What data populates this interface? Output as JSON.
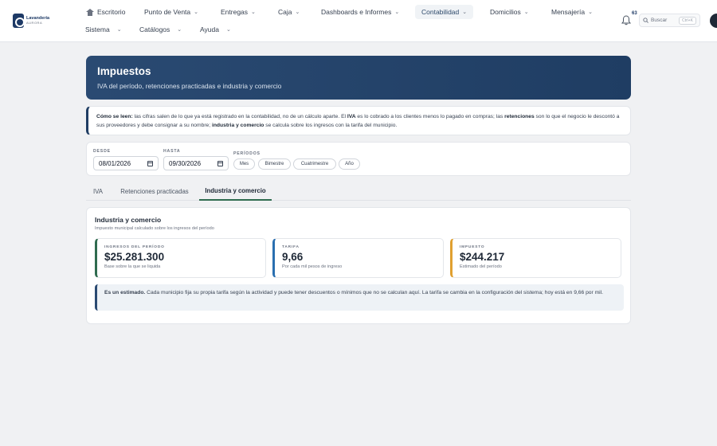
{
  "brand": {
    "line1": "Lavandería",
    "line2": "AURORA"
  },
  "nav": {
    "row1": [
      {
        "label": "Escritorio"
      },
      {
        "label": "Punto de Venta"
      },
      {
        "label": "Entregas"
      },
      {
        "label": "Caja"
      },
      {
        "label": "Dashboards e Informes"
      },
      {
        "label": "Contabilidad"
      },
      {
        "label": "Domicilios"
      },
      {
        "label": "Mensajería"
      }
    ],
    "row2": [
      {
        "label": "Sistema"
      },
      {
        "label": "Catálogos"
      },
      {
        "label": "Ayuda"
      }
    ],
    "active": "Contabilidad",
    "notifications": "63",
    "search_label": "Buscar",
    "search_shortcut": "Ctrl+K"
  },
  "hero": {
    "title": "Impuestos",
    "subtitle": "IVA del período, retenciones practicadas e industria y comercio"
  },
  "info": {
    "lead": "Cómo se leen:",
    "t1": " las cifras salen de lo que ya está registrado en la contabilidad, no de un cálculo aparte. El ",
    "b1": "IVA",
    "t2": " es lo cobrado a los clientes menos lo pagado en compras; las ",
    "b2": "retenciones",
    "t3": " son lo que el negocio le descontó a sus proveedores y debe consignar a su nombre; ",
    "b3": "industria y comercio",
    "t4": " se calcula sobre los ingresos con la tarifa del municipio."
  },
  "filters": {
    "desde_label": "Desde",
    "desde_value": "08/01/2026",
    "hasta_label": "Hasta",
    "hasta_value": "09/30/2026",
    "periodos_label": "Períodos",
    "periodos": [
      "Mes",
      "Bimestre",
      "Cuatrimestre",
      "Año"
    ]
  },
  "tabs": [
    "IVA",
    "Retenciones practicadas",
    "Industria y comercio"
  ],
  "active_tab": "Industria y comercio",
  "section": {
    "title": "Industria y comercio",
    "subtitle": "Impuesto municipal calculado sobre los ingresos del período"
  },
  "stats": [
    {
      "label": "Ingresos del período",
      "value": "$25.281.300",
      "note": "Base sobre la que se liquida",
      "color": "#2f6b4f"
    },
    {
      "label": "Tarifa",
      "value": "9,66",
      "note": "Por cada mil pesos de ingreso",
      "color": "#2a6fb0"
    },
    {
      "label": "Impuesto",
      "value": "$244.217",
      "note": "Estimado del período",
      "color": "#e0a030"
    }
  ],
  "note": {
    "lead": "Es un estimado.",
    "text": " Cada municipio fija su propia tarifa según la actividad y puede tener descuentos o mínimos que no se calculan aquí. La tarifa se cambia en la configuración del sistema; hoy está en 9,66 por mil."
  }
}
